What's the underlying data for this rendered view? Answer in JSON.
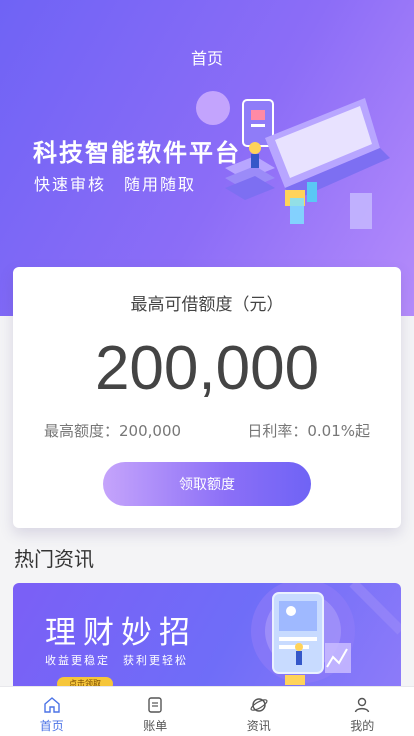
{
  "header": {
    "title": "首页"
  },
  "banner": {
    "title": "科技智能软件平台",
    "subtitle": "快速审核　随用随取"
  },
  "loan_card": {
    "label": "最高可借额度（元）",
    "amount": "200,000",
    "max_label": "最高额度：200,000",
    "rate_label": "日利率：0.01%起",
    "button_label": "领取额度"
  },
  "news": {
    "section_title": "热门资讯",
    "banner_title": "理财妙招",
    "banner_subtitle": "收益更稳定　获利更轻松",
    "banner_button": "点击领取"
  },
  "tabbar": {
    "items": [
      {
        "label": "首页",
        "icon": "home-icon",
        "active": true
      },
      {
        "label": "账单",
        "icon": "bill-icon",
        "active": false
      },
      {
        "label": "资讯",
        "icon": "planet-icon",
        "active": false
      },
      {
        "label": "我的",
        "icon": "user-icon",
        "active": false
      }
    ]
  },
  "colors": {
    "accent": "#4c73e6",
    "hero_start": "#6f63f5",
    "hero_end": "#b58cfb"
  }
}
